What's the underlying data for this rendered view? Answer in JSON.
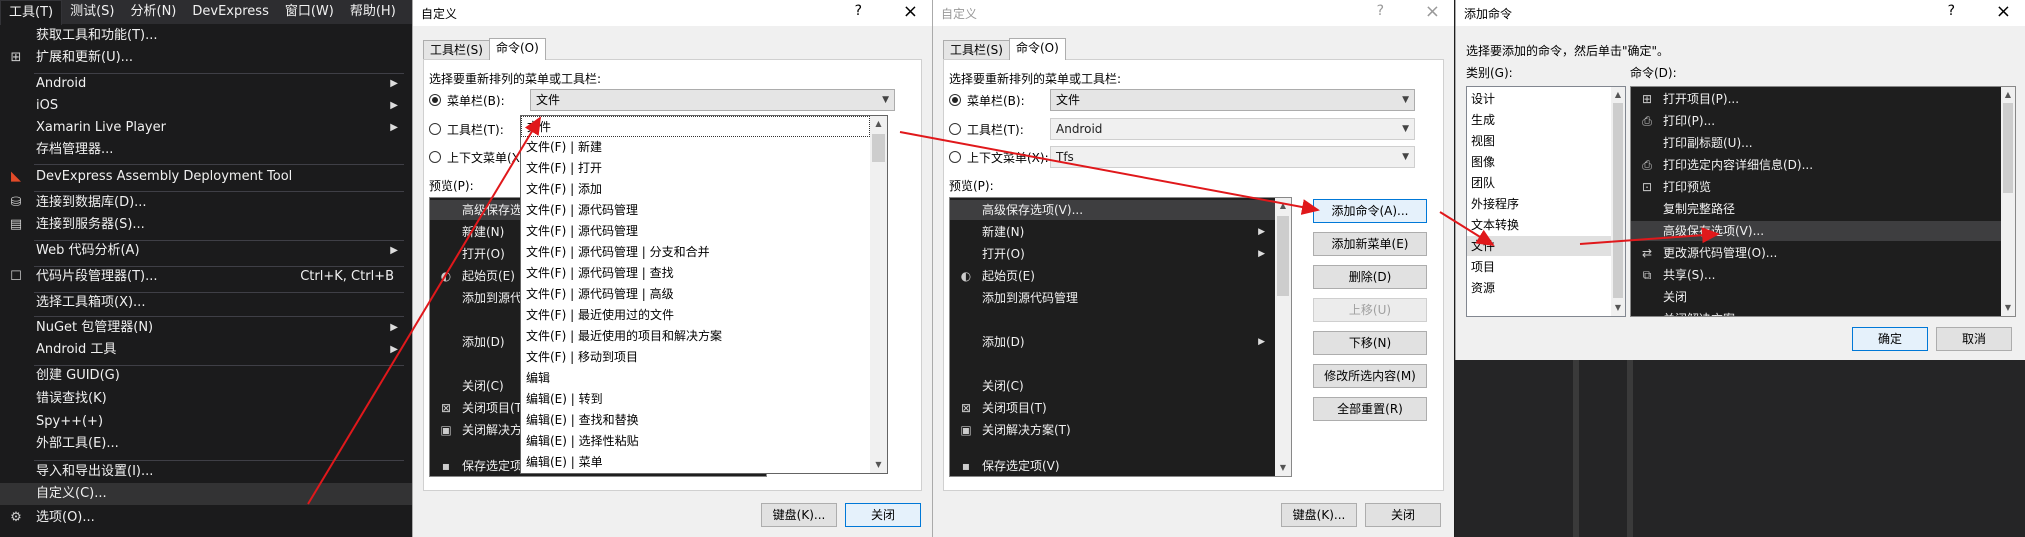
{
  "tools_menu": {
    "menubar": [
      "工具(T)",
      "测试(S)",
      "分析(N)",
      "DevExpress",
      "窗口(W)",
      "帮助(H)"
    ],
    "items": [
      {
        "label": "获取工具和功能(T)...",
        "shortcut": "",
        "icon": ""
      },
      {
        "label": "扩展和更新(U)...",
        "shortcut": "",
        "icon": "extensions-icon"
      },
      {
        "label": "Android",
        "submenu": true
      },
      {
        "label": "iOS",
        "submenu": true
      },
      {
        "label": "Xamarin Live Player",
        "submenu": true
      },
      {
        "label": "存档管理器...",
        "submenu": false
      },
      {
        "label": "DevExpress Assembly Deployment Tool",
        "icon": "devexpress-icon"
      },
      {
        "label": "连接到数据库(D)...",
        "icon": "database-icon"
      },
      {
        "label": "连接到服务器(S)...",
        "icon": "server-icon"
      },
      {
        "label": "Web 代码分析(A)",
        "submenu": true
      },
      {
        "label": "代码片段管理器(T)...",
        "shortcut": "Ctrl+K, Ctrl+B",
        "icon": "snippet-icon"
      },
      {
        "label": "选择工具箱项(X)..."
      },
      {
        "label": "NuGet 包管理器(N)",
        "submenu": true
      },
      {
        "label": "Android 工具",
        "submenu": true
      },
      {
        "label": "创建 GUID(G)"
      },
      {
        "label": "错误查找(K)"
      },
      {
        "label": "Spy++(+)"
      },
      {
        "label": "外部工具(E)..."
      },
      {
        "label": "导入和导出设置(I)..."
      },
      {
        "label": "自定义(C)..."
      },
      {
        "label": "选项(O)...",
        "icon": "gear-icon"
      }
    ]
  },
  "customize1": {
    "title": "自定义",
    "help": "?",
    "close": "×",
    "tabs": [
      "工具栏(S)",
      "命令(O)"
    ],
    "instruction": "选择要重新排列的菜单或工具栏:",
    "radio_menubar": "菜单栏(B):",
    "radio_toolbar": "工具栏(T):",
    "radio_context": "上下文菜单(X):",
    "menubar_value": "文件",
    "preview_label": "预览(P):",
    "preview_items": [
      "高级保存选项(V)...",
      "新建(N)",
      "打开(O)",
      "起始页(E)",
      "添加到源代码",
      "添加(D)",
      "关闭(C)",
      "关闭项目(T)",
      "关闭解决方案",
      "保存选定项(..."
    ],
    "dropdown_items": [
      "文件",
      "文件(F) | 新建",
      "文件(F) | 打开",
      "文件(F) | 添加",
      "文件(F) | 源代码管理",
      "文件(F) | 源代码管理",
      "文件(F) | 源代码管理 | 分支和合并",
      "文件(F) | 源代码管理 | 查找",
      "文件(F) | 源代码管理 | 高级",
      "文件(F) | 最近使用过的文件",
      "文件(F) | 最近使用的项目和解决方案",
      "文件(F) | 移动到项目",
      "编辑",
      "编辑(E) | 转到",
      "编辑(E) | 查找和替换",
      "编辑(E) | 选择性粘贴",
      "编辑(E) | 菜单"
    ],
    "keyboard_button": "键盘(K)...",
    "close_button": "关闭"
  },
  "customize2": {
    "title": "自定义",
    "help": "?",
    "close": "×",
    "tabs": [
      "工具栏(S)",
      "命令(O)"
    ],
    "instruction": "选择要重新排列的菜单或工具栏:",
    "radio_menubar": "菜单栏(B):",
    "radio_toolbar": "工具栏(T):",
    "radio_context": "上下文菜单(X):",
    "menubar_value": "文件",
    "toolbar_value": "Android",
    "context_value": "Tfs",
    "preview_label": "预览(P):",
    "preview_items": [
      "高级保存选项(V)...",
      "新建(N)",
      "打开(O)",
      "起始页(E)",
      "添加到源代码管理",
      "添加(D)",
      "关闭(C)",
      "关闭项目(T)",
      "关闭解决方案(T)",
      "保存选定项(V)"
    ],
    "buttons": [
      "添加命令(A)...",
      "添加新菜单(E)",
      "删除(D)",
      "上移(U)",
      "下移(N)",
      "修改所选内容(M)",
      "全部重置(R)"
    ],
    "keyboard_button": "键盘(K)...",
    "close_button": "关闭"
  },
  "add_command": {
    "title": "添加命令",
    "help": "?",
    "close": "×",
    "instruction": "选择要添加的命令，然后单击\"确定\"。",
    "category_label": "类别(G):",
    "command_label": "命令(D):",
    "categories": [
      "设计",
      "生成",
      "视图",
      "图像",
      "团队",
      "外接程序",
      "文本转换",
      "文件",
      "项目",
      "资源"
    ],
    "selected_category": "文件",
    "commands": [
      "打开项目(P)...",
      "打印(P)...",
      "打印副标题(U)...",
      "打印选定内容详细信息(D)...",
      "打印预览",
      "复制完整路径",
      "高级保存选项(V)...",
      "更改源代码管理(O)...",
      "共享(S)...",
      "关闭",
      "关闭解决方案"
    ],
    "selected_command": "高级保存选项(V)...",
    "ok_button": "确定",
    "cancel_button": "取消"
  },
  "colors": {
    "arrow": "#e0181b",
    "dark_bg": "#1b1b1c",
    "dialog_bg": "#f0f0f0",
    "accent": "#0078d7"
  }
}
